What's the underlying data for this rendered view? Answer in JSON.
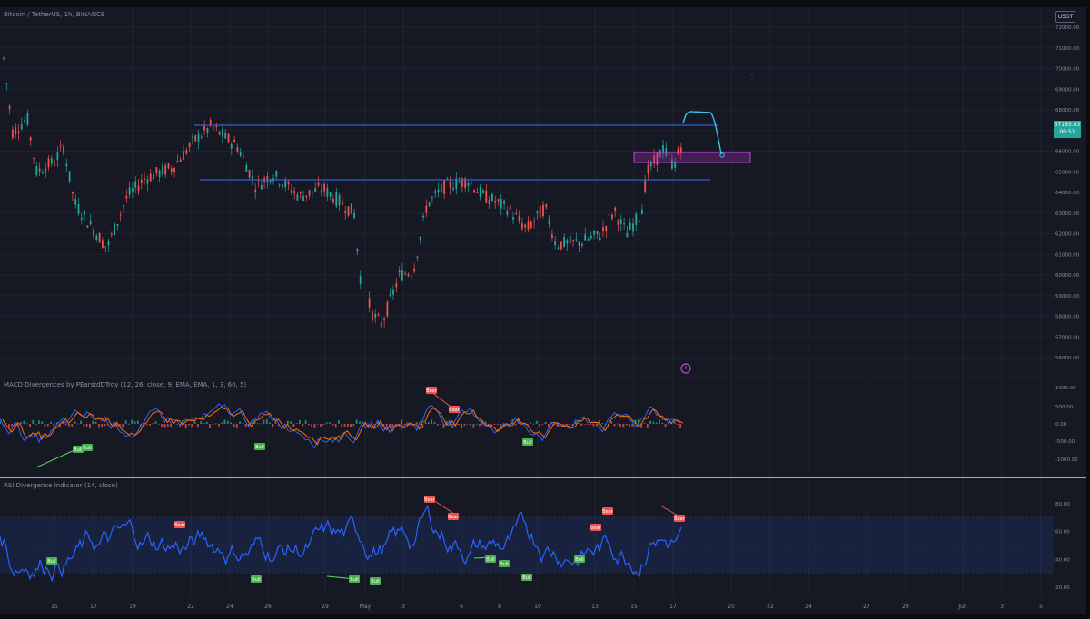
{
  "header": {
    "symbol_title": "Bitcoin / TetherUS, 1h, BINANCE",
    "currency_badge": "USDT"
  },
  "price_pane": {
    "current_price": "67165.03",
    "current_sub": "00:51",
    "price_axis": [
      "72000.00",
      "71000.00",
      "70000.00",
      "69000.00",
      "68000.00",
      "67000.00",
      "66000.00",
      "65000.00",
      "64000.00",
      "63000.00",
      "62000.00",
      "61000.00",
      "60000.00",
      "59000.00",
      "58000.00",
      "57000.00",
      "56000.00"
    ],
    "resistance_level": 67150,
    "support_level": 64670,
    "zone": {
      "from": 65500,
      "to": 65900
    }
  },
  "macd_pane": {
    "title": "MACD Divergences by PEarstdDTrdy (12, 26, close, 9, EMA, EMA, 1, 3, 60, 5)",
    "axis": [
      "1000.00",
      "500.00",
      "0.00",
      "-500.00",
      "-1000.00"
    ],
    "signals": [
      {
        "type": "bull",
        "label": "Bull"
      },
      {
        "type": "bull",
        "label": "Bull"
      },
      {
        "type": "bull",
        "label": "Bull"
      },
      {
        "type": "bear",
        "label": "Bear"
      },
      {
        "type": "bear",
        "label": "Bear"
      },
      {
        "type": "bull",
        "label": "Bull"
      }
    ]
  },
  "rsi_pane": {
    "title": "RSI Divergence Indicator (14, close)",
    "axis": [
      "80.00",
      "60.00",
      "40.00",
      "20.00"
    ],
    "band": {
      "upper": 70,
      "lower": 30
    },
    "signals": [
      {
        "type": "bull",
        "label": "Bull"
      },
      {
        "type": "bear",
        "label": "Bear"
      },
      {
        "type": "bull",
        "label": "Bull"
      },
      {
        "type": "bull",
        "label": "Bull"
      },
      {
        "type": "bull",
        "label": "Bull"
      },
      {
        "type": "bear",
        "label": "Bear"
      },
      {
        "type": "bear",
        "label": "Bear"
      },
      {
        "type": "bull",
        "label": "Bull"
      },
      {
        "type": "bull",
        "label": "Bull"
      },
      {
        "type": "bull",
        "label": "Bull"
      },
      {
        "type": "bull",
        "label": "Bull"
      },
      {
        "type": "bear",
        "label": "Bear"
      },
      {
        "type": "bear",
        "label": "Bear"
      },
      {
        "type": "bear",
        "label": "Bear"
      }
    ]
  },
  "time_axis": [
    "15",
    "17",
    "19",
    "22",
    "24",
    "26",
    "29",
    "May",
    "3",
    "6",
    "8",
    "10",
    "13",
    "15",
    "17",
    "20",
    "22",
    "24",
    "27",
    "29",
    "Jun",
    "3",
    "5"
  ],
  "colors": {
    "background": "#161823",
    "bull_candle": "#26a69a",
    "bear_candle": "#ef5350",
    "level_line": "#2f5fd6",
    "zone": "#9c27b0",
    "rsi_line": "#2962ff",
    "macd_line": "#2962ff",
    "signal_line": "#ff6d00",
    "projection": "#38c6e0"
  }
}
